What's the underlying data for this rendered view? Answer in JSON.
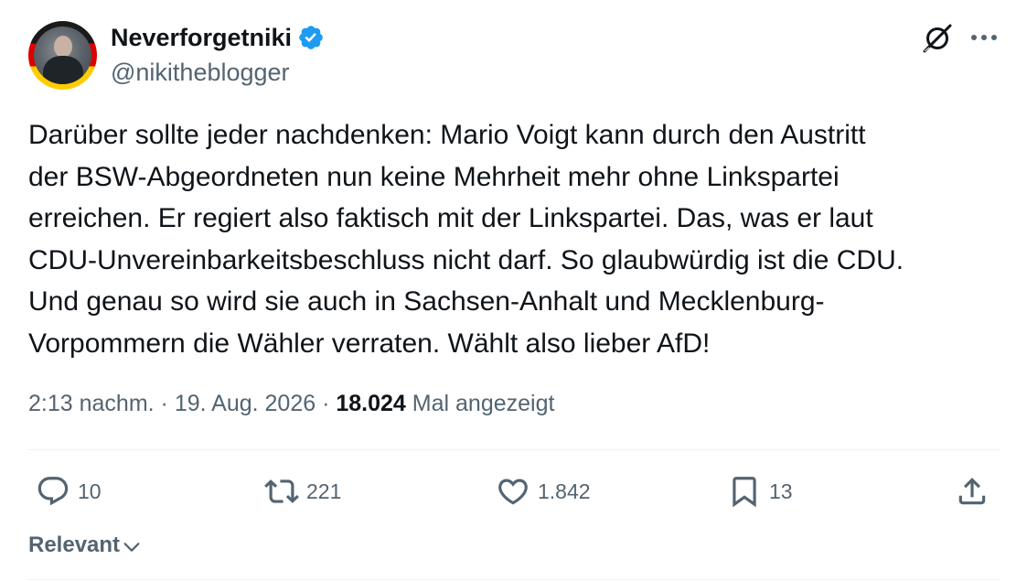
{
  "author": {
    "display_name": "Neverforgetniki",
    "handle": "@nikitheblogger",
    "verified": true,
    "accent_color": "#1d9bf0"
  },
  "header_icons": [
    "grok-icon",
    "more-icon"
  ],
  "tweet": {
    "text": "Darüber sollte jeder nachdenken: Mario Voigt kann durch den Austritt\nder BSW-Abgeordneten nun keine Mehrheit mehr ohne Linkspartei\nerreichen. Er regiert also faktisch mit der Linkspartei. Das, was er laut\nCDU-Unvereinbarkeitsbeschluss nicht darf. So glaubwürdig ist die CDU.\nUnd genau so wird sie auch in Sachsen-Anhalt und Mecklenburg-\nVorpommern die Wähler verraten. Wählt also lieber AfD!",
    "time": "2:13 nachm.",
    "date": "19. Aug. 2026",
    "views_count": "18.024",
    "views_label": "Mal angezeigt",
    "separator": "·"
  },
  "actions": {
    "replies": "10",
    "reposts": "221",
    "likes": "1.842",
    "bookmarks": "13"
  },
  "sort": {
    "label": "Relevant"
  },
  "colors": {
    "text_primary": "#0f1419",
    "text_secondary": "#536471",
    "divider": "#eff3f4",
    "verified_blue": "#1d9bf0"
  }
}
